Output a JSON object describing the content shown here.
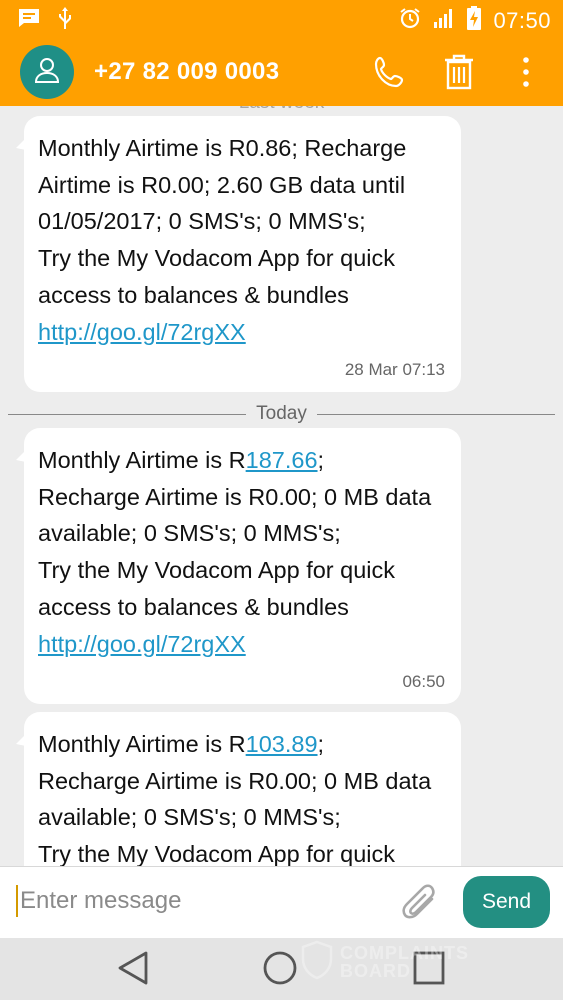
{
  "status": {
    "time": "07:50",
    "icons": [
      "message-notification-icon",
      "usb-icon",
      "alarm-icon",
      "signal-icon",
      "battery-charging-icon"
    ]
  },
  "header": {
    "contact": "+27 82 009 0003",
    "icons": [
      "contact-avatar-icon",
      "phone-icon",
      "delete-icon",
      "more-options-icon"
    ]
  },
  "thread": {
    "faded_date": "Last week",
    "messages": [
      {
        "text": "Monthly Airtime is R0.86; Recharge Airtime is R0.00; 2.60 GB data until 01/05/2017; 0 SMS's; 0 MMS's;\nTry the My Vodacom App for quick access to balances & bundles ",
        "link": "http://goo.gl/72rgXX",
        "timestamp": "28 Mar 07:13"
      },
      {
        "prefix": "Monthly Airtime is R",
        "amount": "187.66",
        "text": ";\nRecharge Airtime is R0.00; 0 MB data available; 0 SMS's; 0 MMS's;\nTry the My Vodacom App for quick access to balances & bundles ",
        "link": "http://goo.gl/72rgXX",
        "timestamp": "06:50"
      },
      {
        "prefix": "Monthly Airtime is R",
        "amount": "103.89",
        "text": ";\nRecharge Airtime is R0.00; 0 MB data available; 0 SMS's; 0 MMS's;\nTry the My Vodacom App for quick"
      }
    ],
    "divider_label": "Today"
  },
  "composer": {
    "placeholder": "Enter message",
    "send_label": "Send"
  },
  "watermark": {
    "line1": "COMPLAINTS",
    "line2": "BOARD"
  },
  "colors": {
    "header": "#ffa000",
    "accent": "#238f82",
    "link": "#1f97c9"
  }
}
